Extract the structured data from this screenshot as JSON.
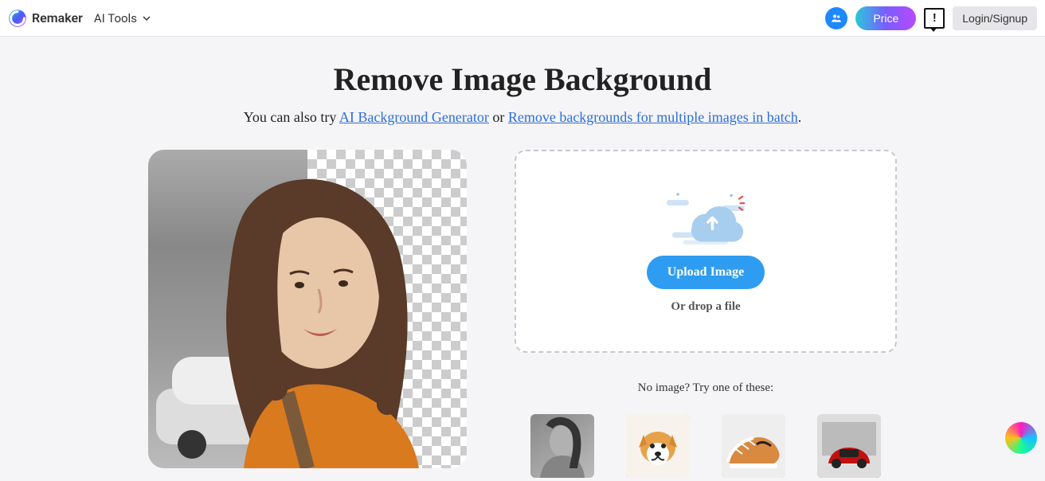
{
  "header": {
    "brand": "Remaker",
    "nav_label": "AI Tools",
    "price_label": "Price",
    "login_label": "Login/Signup"
  },
  "hero": {
    "title": "Remove Image Background",
    "sub_prefix": "You can also try ",
    "link1": "AI Background Generator",
    "sub_mid": " or ",
    "link2": "Remove backgrounds for multiple images in batch",
    "sub_suffix": "."
  },
  "upload": {
    "button_label": "Upload Image",
    "drop_label": "Or drop a file"
  },
  "samples": {
    "intro": "No image? Try one of these:"
  }
}
